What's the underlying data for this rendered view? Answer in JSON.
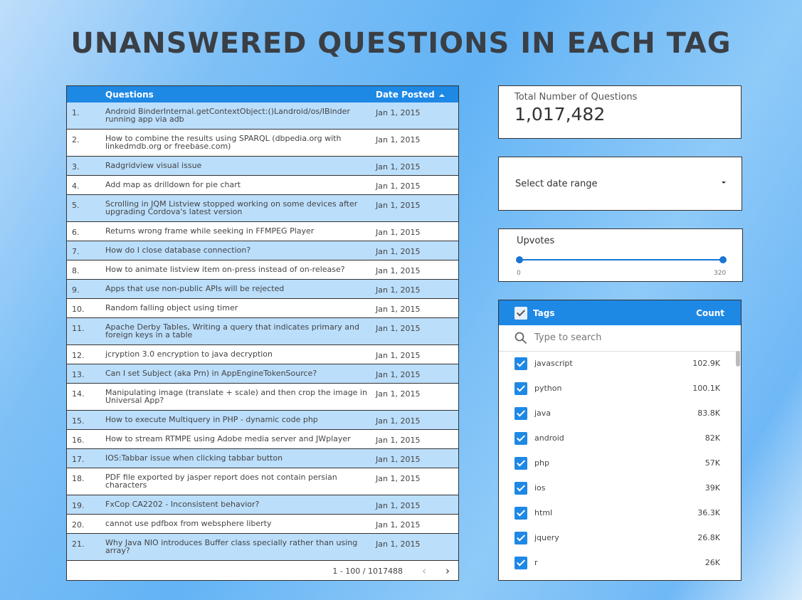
{
  "title": "UNANSWERED QUESTIONS IN EACH TAG",
  "table": {
    "col_question": "Questions",
    "col_date": "Date Posted",
    "rows": [
      {
        "num": "1.",
        "question": "Android BinderInternal.getContextObject:()Landroid/os/IBinder running app via adb",
        "date": "Jan 1, 2015"
      },
      {
        "num": "2.",
        "question": "How to combine the results using SPARQL (dbpedia.org with linkedmdb.org or freebase.com)",
        "date": "Jan 1, 2015"
      },
      {
        "num": "3.",
        "question": "Radgridview visual issue",
        "date": "Jan 1, 2015"
      },
      {
        "num": "4.",
        "question": "Add map as drilldown for pie chart",
        "date": "Jan 1, 2015"
      },
      {
        "num": "5.",
        "question": "Scrolling in JQM Listview stopped working on some devices after upgrading Cordova's latest version",
        "date": "Jan 1, 2015"
      },
      {
        "num": "6.",
        "question": "Returns wrong frame while seeking in FFMPEG Player",
        "date": "Jan 1, 2015"
      },
      {
        "num": "7.",
        "question": "How do I close database connection?",
        "date": "Jan 1, 2015"
      },
      {
        "num": "8.",
        "question": "How to animate listview item on-press instead of on-release?",
        "date": "Jan 1, 2015"
      },
      {
        "num": "9.",
        "question": "Apps that use non-public APIs will be rejected",
        "date": "Jan 1, 2015"
      },
      {
        "num": "10.",
        "question": "Random falling object using timer",
        "date": "Jan 1, 2015"
      },
      {
        "num": "11.",
        "question": "Apache Derby Tables, Writing a query that indicates primary and foreign keys in a table",
        "date": "Jan 1, 2015"
      },
      {
        "num": "12.",
        "question": "jcryption 3.0 encryption to java decryption",
        "date": "Jan 1, 2015"
      },
      {
        "num": "13.",
        "question": "Can I set Subject (aka Prn) in AppEngineTokenSource?",
        "date": "Jan 1, 2015"
      },
      {
        "num": "14.",
        "question": "Manipulating image (translate + scale) and then crop the image in Universal App?",
        "date": "Jan 1, 2015"
      },
      {
        "num": "15.",
        "question": "How to execute Multiquery in PHP - dynamic code php",
        "date": "Jan 1, 2015"
      },
      {
        "num": "16.",
        "question": "How to stream RTMPE using Adobe media server and JWplayer",
        "date": "Jan 1, 2015"
      },
      {
        "num": "17.",
        "question": "IOS:Tabbar issue when clicking tabbar button",
        "date": "Jan 1, 2015"
      },
      {
        "num": "18.",
        "question": "PDF file exported by jasper report does not contain persian characters",
        "date": "Jan 1, 2015"
      },
      {
        "num": "19.",
        "question": "FxCop CA2202 - Inconsistent behavior?",
        "date": "Jan 1, 2015"
      },
      {
        "num": "20.",
        "question": "cannot use pdfbox from websphere liberty",
        "date": "Jan 1, 2015"
      },
      {
        "num": "21.",
        "question": "Why Java NIO introduces Buffer class specially rather than using array?",
        "date": "Jan 1, 2015"
      }
    ],
    "pager_text": "1 - 100 / 1017488"
  },
  "total": {
    "label": "Total Number of Questions",
    "value": "1,017,482"
  },
  "date_range": {
    "label": "Select date range"
  },
  "upvotes": {
    "label": "Upvotes",
    "min": "0",
    "max": "320"
  },
  "tags": {
    "header_label": "Tags",
    "header_count": "Count",
    "search_placeholder": "Type to search",
    "items": [
      {
        "name": "javascript",
        "count": "102.9K"
      },
      {
        "name": "python",
        "count": "100.1K"
      },
      {
        "name": "java",
        "count": "83.8K"
      },
      {
        "name": "android",
        "count": "82K"
      },
      {
        "name": "php",
        "count": "57K"
      },
      {
        "name": "ios",
        "count": "39K"
      },
      {
        "name": "html",
        "count": "36.3K"
      },
      {
        "name": "jquery",
        "count": "26.8K"
      },
      {
        "name": "r",
        "count": "26K"
      }
    ]
  },
  "colors": {
    "accent": "#1e88e5",
    "row_alt": "#bbdefb"
  }
}
